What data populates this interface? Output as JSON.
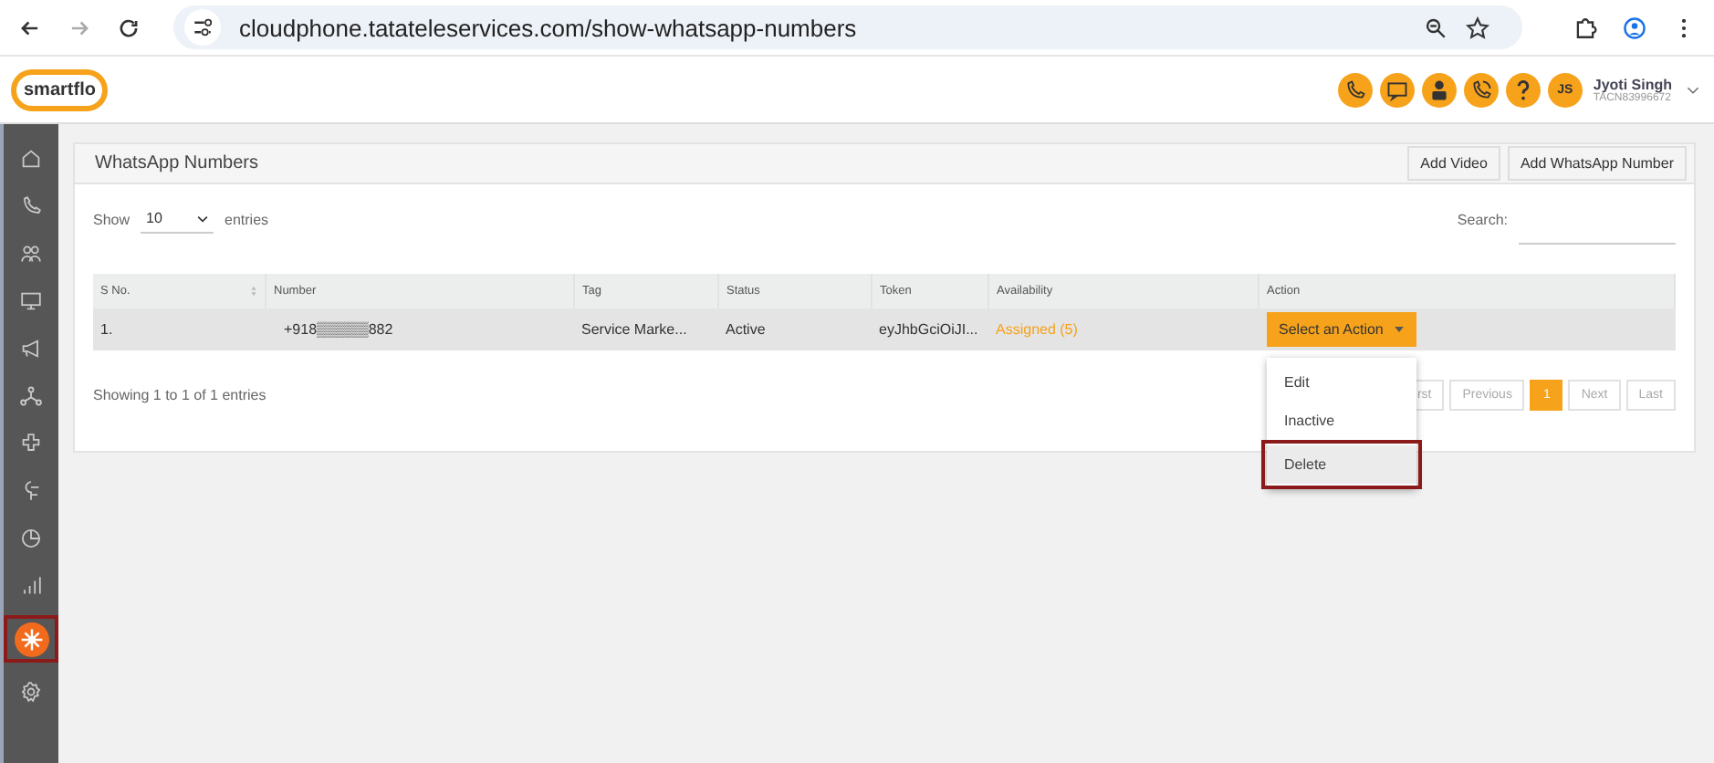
{
  "browser": {
    "url": "cloudphone.tatateleservices.com/show-whatsapp-numbers"
  },
  "header": {
    "logo": "smartflo",
    "user": {
      "initials": "JS",
      "name": "Jyoti Singh",
      "id": "TACN83996672"
    }
  },
  "sidebar": {
    "items": [
      {
        "selected": false,
        "highlighted": false
      },
      {
        "selected": false,
        "highlighted": false
      },
      {
        "selected": false,
        "highlighted": false
      },
      {
        "selected": false,
        "highlighted": false
      },
      {
        "selected": false,
        "highlighted": false
      },
      {
        "selected": false,
        "highlighted": false
      },
      {
        "selected": false,
        "highlighted": false
      },
      {
        "selected": false,
        "highlighted": false
      },
      {
        "selected": false,
        "highlighted": false
      },
      {
        "selected": false,
        "highlighted": false
      },
      {
        "selected": true,
        "highlighted": true
      },
      {
        "selected": false,
        "highlighted": false
      }
    ]
  },
  "card": {
    "title": "WhatsApp Numbers",
    "buttons": [
      "Add Video",
      "Add WhatsApp Number"
    ],
    "show_label": "Show",
    "page_size": "10",
    "entries_label": "entries",
    "search_label": "Search:",
    "table": {
      "columns": [
        "S No.",
        "Number",
        "Tag",
        "Status",
        "Token",
        "Availability",
        "Action"
      ],
      "rows": [
        {
          "sno": "1.",
          "number": "+918▒▒▒▒▒882",
          "tag": "Service Marke...",
          "status": "Active",
          "token": "eyJhbGciOiJI...",
          "availability": "Assigned (5)",
          "action": "Select an Action"
        }
      ]
    },
    "info": "Showing 1 to 1 of 1 entries",
    "pagination": [
      {
        "label": "rst",
        "selected": false
      },
      {
        "label": "Previous",
        "selected": false
      },
      {
        "label": "1",
        "selected": true
      },
      {
        "label": "Next",
        "selected": false
      },
      {
        "label": "Last",
        "selected": false
      }
    ],
    "menu": [
      {
        "label": "Edit",
        "highlighted": false
      },
      {
        "label": "Inactive",
        "highlighted": false
      },
      {
        "label": "Delete",
        "highlighted": true
      }
    ]
  }
}
